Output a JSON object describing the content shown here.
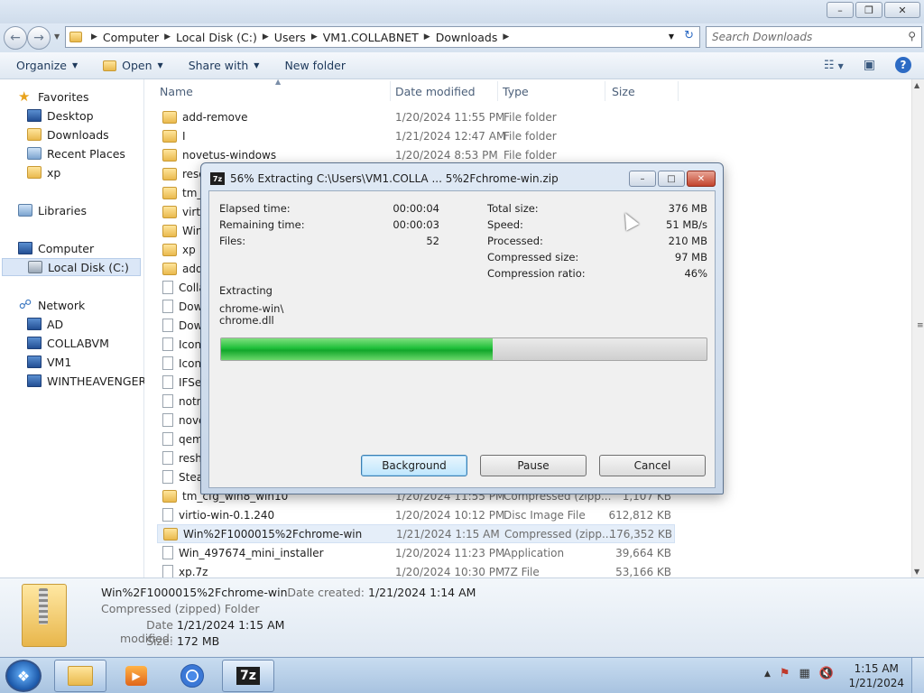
{
  "explorer": {
    "breadcrumb": [
      "Computer",
      "Local Disk (C:)",
      "Users",
      "VM1.COLLABNET",
      "Downloads"
    ],
    "search_placeholder": "Search Downloads",
    "toolbar": {
      "organize": "Organize",
      "open": "Open",
      "share_with": "Share with",
      "new_folder": "New folder"
    },
    "nav": {
      "favorites": "Favorites",
      "desktop": "Desktop",
      "downloads": "Downloads",
      "recent_places": "Recent Places",
      "xp": "xp",
      "libraries": "Libraries",
      "computer": "Computer",
      "local_disk": "Local Disk (C:)",
      "network": "Network",
      "ad": "AD",
      "collabvm": "COLLABVM",
      "vm1": "VM1",
      "wintheavengers": "WINTHEAVENGERS"
    },
    "columns": {
      "name": "Name",
      "date": "Date modified",
      "type": "Type",
      "size": "Size"
    },
    "files": [
      {
        "name": "add-remove",
        "date": "1/20/2024 11:55 PM",
        "type": "File folder",
        "size": ""
      },
      {
        "name": "I",
        "date": "1/21/2024 12:47 AM",
        "type": "File folder",
        "size": ""
      },
      {
        "name": "novetus-windows",
        "date": "1/20/2024 8:53 PM",
        "type": "File folder",
        "size": ""
      },
      {
        "name": "reso",
        "date": "",
        "type": "",
        "size": ""
      },
      {
        "name": "tm_c",
        "date": "",
        "type": "",
        "size": ""
      },
      {
        "name": "virtio",
        "date": "",
        "type": "",
        "size": ""
      },
      {
        "name": "Win%",
        "date": "",
        "type": "",
        "size": ""
      },
      {
        "name": "xp",
        "date": "",
        "type": "",
        "size": ""
      },
      {
        "name": "add-",
        "date": "",
        "type": "",
        "size": ""
      },
      {
        "name": "Colla",
        "date": "",
        "type": "",
        "size": ""
      },
      {
        "name": "Dow",
        "date": "",
        "type": "",
        "size": ""
      },
      {
        "name": "Dow",
        "date": "",
        "type": "",
        "size": ""
      },
      {
        "name": "Icon",
        "date": "",
        "type": "",
        "size": ""
      },
      {
        "name": "Icon",
        "date": "",
        "type": "",
        "size": ""
      },
      {
        "name": "IFSet",
        "date": "",
        "type": "",
        "size": ""
      },
      {
        "name": "notn",
        "date": "",
        "type": "",
        "size": ""
      },
      {
        "name": "nove",
        "date": "",
        "type": "",
        "size": ""
      },
      {
        "name": "qem",
        "date": "",
        "type": "",
        "size": ""
      },
      {
        "name": "resha",
        "date": "",
        "type": "",
        "size": ""
      },
      {
        "name": "Stea",
        "date": "",
        "type": "",
        "size": ""
      },
      {
        "name": "tm_cfg_win8_win10",
        "date": "1/20/2024 11:55 PM",
        "type": "Compressed (zipp...",
        "size": "1,107 KB"
      },
      {
        "name": "virtio-win-0.1.240",
        "date": "1/20/2024 10:12 PM",
        "type": "Disc Image File",
        "size": "612,812 KB"
      },
      {
        "name": "Win%2F1000015%2Fchrome-win",
        "date": "1/21/2024 1:15 AM",
        "type": "Compressed (zipp...",
        "size": "176,352 KB"
      },
      {
        "name": "Win_497674_mini_installer",
        "date": "1/20/2024 11:23 PM",
        "type": "Application",
        "size": "39,664 KB"
      },
      {
        "name": "xp.7z",
        "date": "1/20/2024 10:30 PM",
        "type": "7Z File",
        "size": "53,166 KB"
      }
    ],
    "details": {
      "name": "Win%2F1000015%2Fchrome-win",
      "type": "Compressed (zipped) Folder",
      "date_modified_label": "Date modified:",
      "date_modified": "1/21/2024 1:15 AM",
      "size_label": "Size:",
      "size": "172 MB",
      "date_created_label": "Date created:",
      "date_created": "1/21/2024 1:14 AM"
    }
  },
  "dialog": {
    "title": "56% Extracting C:\\Users\\VM1.COLLA ... 5%2Fchrome-win.zip",
    "elapsed_label": "Elapsed time:",
    "elapsed": "00:00:04",
    "remaining_label": "Remaining time:",
    "remaining": "00:00:03",
    "files_label": "Files:",
    "files": "52",
    "total_size_label": "Total size:",
    "total_size": "376 MB",
    "speed_label": "Speed:",
    "speed": "51 MB/s",
    "processed_label": "Processed:",
    "processed": "210 MB",
    "compressed_size_label": "Compressed size:",
    "compressed_size": "97 MB",
    "ratio_label": "Compression ratio:",
    "ratio": "46%",
    "extracting_label": "Extracting",
    "current_dir": "chrome-win\\",
    "current_file": "chrome.dll",
    "progress_percent": 56,
    "background_btn": "Background",
    "pause_btn": "Pause",
    "cancel_btn": "Cancel"
  },
  "taskbar": {
    "sevenzip_label": "7z",
    "time": "1:15 AM",
    "date": "1/21/2024"
  }
}
